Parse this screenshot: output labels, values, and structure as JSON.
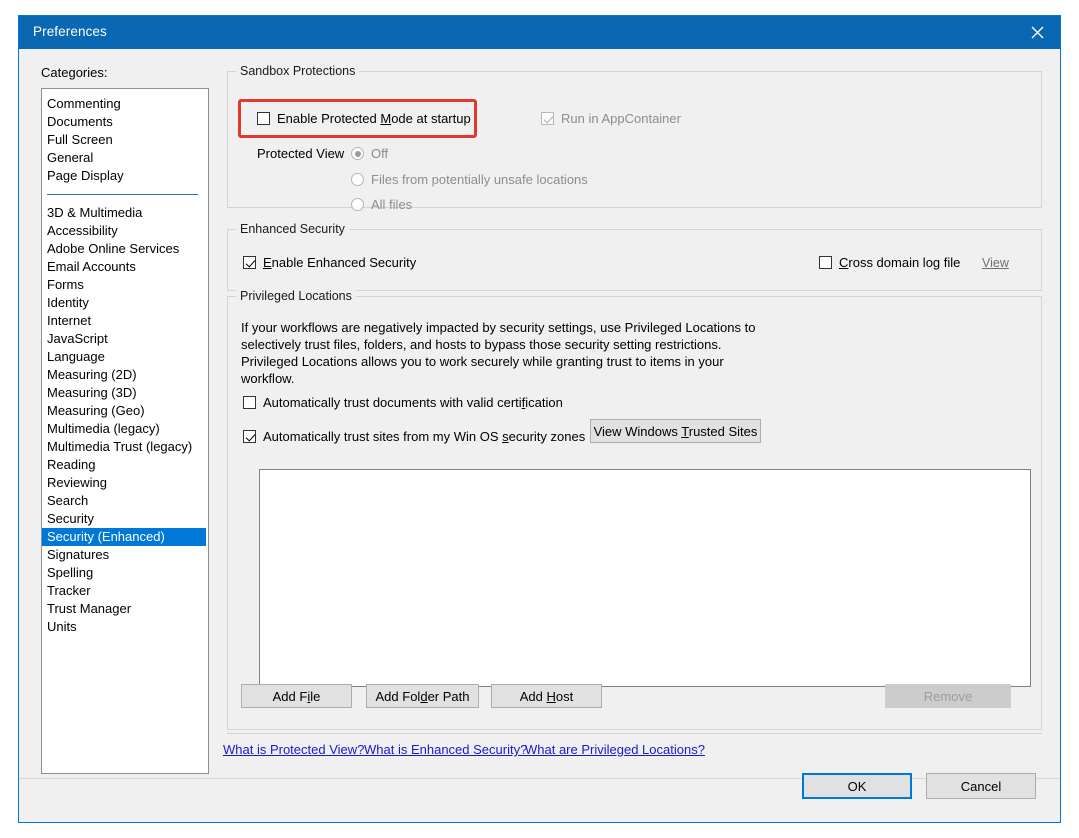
{
  "window": {
    "title": "Preferences",
    "close_icon": "close-icon"
  },
  "sidebar": {
    "label": "Categories:",
    "top_items": [
      "Commenting",
      "Documents",
      "Full Screen",
      "General",
      "Page Display"
    ],
    "items": [
      "3D & Multimedia",
      "Accessibility",
      "Adobe Online Services",
      "Email Accounts",
      "Forms",
      "Identity",
      "Internet",
      "JavaScript",
      "Language",
      "Measuring (2D)",
      "Measuring (3D)",
      "Measuring (Geo)",
      "Multimedia (legacy)",
      "Multimedia Trust (legacy)",
      "Reading",
      "Reviewing",
      "Search",
      "Security",
      "Security (Enhanced)",
      "Signatures",
      "Spelling",
      "Tracker",
      "Trust Manager",
      "Units"
    ],
    "selected": "Security (Enhanced)",
    "selection_color": "#0078d7"
  },
  "sandbox": {
    "group_title": "Sandbox Protections",
    "protected_mode": {
      "label_pre": "Enable Protected ",
      "label_accel": "M",
      "label_post": "ode at startup",
      "checked": false,
      "highlight_color": "#e03a2f"
    },
    "app_container": {
      "label": "Run in AppContainer",
      "checked": true,
      "disabled": true
    },
    "protected_view_label": "Protected View",
    "protected_view_options": [
      {
        "label": "Off",
        "selected": true
      },
      {
        "label": "Files from potentially unsafe locations",
        "selected": false
      },
      {
        "label": "All files",
        "selected": false
      }
    ]
  },
  "enhanced": {
    "group_title": "Enhanced Security",
    "enable": {
      "label_accel": "E",
      "label_post": "nable Enhanced Security",
      "checked": true
    },
    "cross_domain": {
      "label_accel": "C",
      "label_post": "ross domain log file",
      "checked": false
    },
    "view_link": "View"
  },
  "privileged": {
    "group_title": "Privileged Locations",
    "description": "If your workflows are negatively impacted by security settings, use Privileged Locations to\nselectively trust files, folders, and hosts to bypass those security setting restrictions.\nPrivileged Locations allows you to work securely while granting trust to items in your\nworkflow.",
    "trust_documents": {
      "label_pre": "Automatically trust documents with valid certi",
      "label_accel": "f",
      "label_post": "ication",
      "checked": false
    },
    "trust_sites": {
      "label_pre": "Automatically trust sites from my Win OS ",
      "label_accel": "s",
      "label_post": "ecurity zones",
      "checked": true
    },
    "view_trusted_sites_button": {
      "pre": "View Windows ",
      "accel": "T",
      "post": "rusted Sites"
    },
    "list_items": [],
    "buttons": [
      {
        "name": "add-file",
        "pre": "Add F",
        "accel": "i",
        "post": "le",
        "disabled": false
      },
      {
        "name": "add-folder-path",
        "pre": "Add Fol",
        "accel": "d",
        "post": "er Path",
        "disabled": false
      },
      {
        "name": "add-host",
        "pre": "Add ",
        "accel": "H",
        "post": "ost",
        "disabled": false
      }
    ],
    "remove_button": {
      "label": "Remove",
      "disabled": true
    }
  },
  "help_links": [
    "What is Protected View?",
    "What is Enhanced Security?",
    "What are Privileged Locations?"
  ],
  "dialog_buttons": {
    "ok": "OK",
    "cancel": "Cancel"
  }
}
